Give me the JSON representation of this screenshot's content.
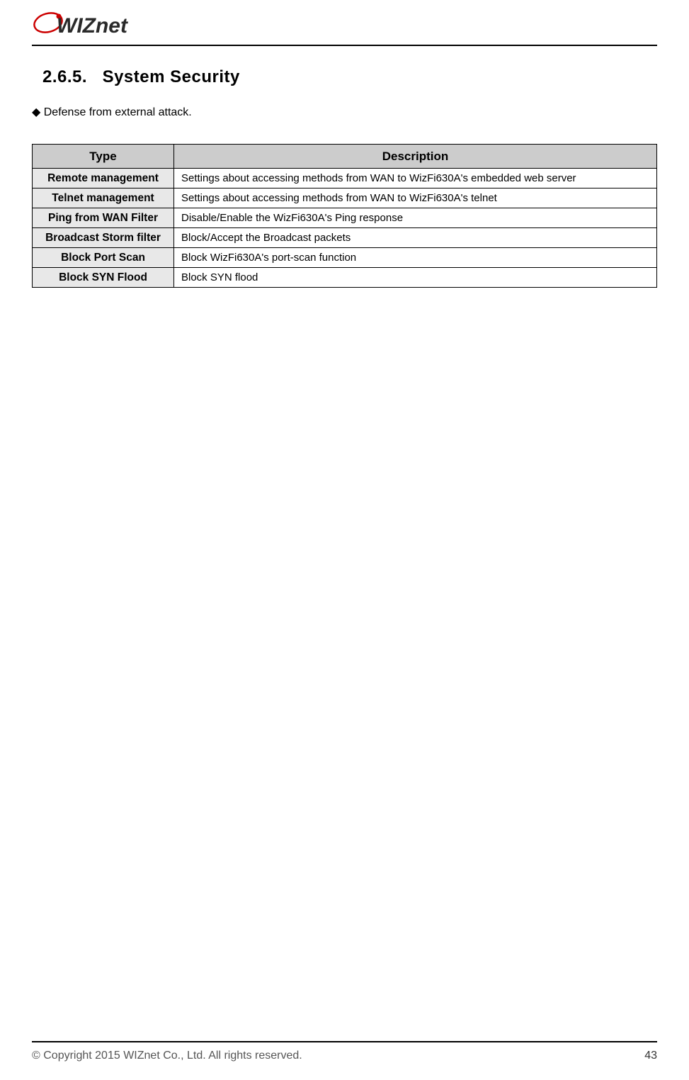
{
  "logo_text": "WIZnet",
  "section_number": "2.6.5.",
  "section_title": "System Security",
  "bullet_text": "◆ Defense from external attack.",
  "table": {
    "headers": {
      "type": "Type",
      "desc": "Description"
    },
    "rows": [
      {
        "type": "Remote management",
        "desc": "Settings about accessing methods from WAN to WizFi630A's embedded web server"
      },
      {
        "type": "Telnet management",
        "desc": "Settings about accessing methods from WAN to WizFi630A's telnet"
      },
      {
        "type": "Ping from WAN Filter",
        "desc": "Disable/Enable the WizFi630A's Ping response"
      },
      {
        "type": "Broadcast Storm filter",
        "desc": "Block/Accept the Broadcast packets"
      },
      {
        "type": "Block Port Scan",
        "desc": "Block WizFi630A's port-scan function"
      },
      {
        "type": "Block SYN Flood",
        "desc": "Block SYN flood"
      }
    ]
  },
  "footer": {
    "copyright": "© Copyright 2015 WIZnet Co., Ltd. All rights reserved.",
    "page": "43"
  }
}
